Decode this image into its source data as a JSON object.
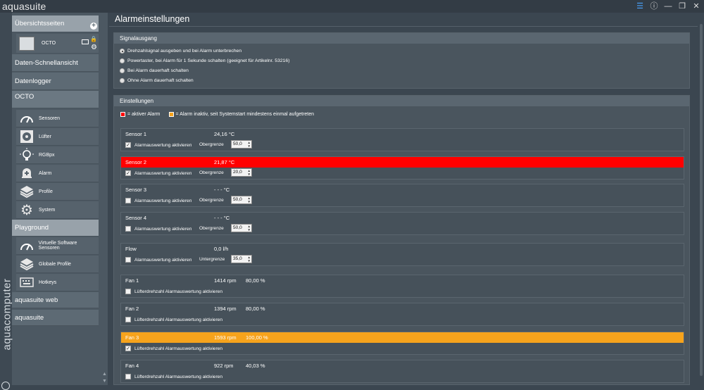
{
  "app": {
    "title": "aquasuite",
    "brand": "aquacomputer"
  },
  "colors": {
    "alarm_active": "#ff0000",
    "alarm_inactive": "#f6a31c",
    "accent": "#4aa3ff"
  },
  "sidebar": {
    "overview_label": "Übersichtsseiten",
    "device_label": "OCTO",
    "data_quick_label": "Daten-Schnellansicht",
    "datalogger_label": "Datenlogger",
    "octo_label": "OCTO",
    "octo_items": [
      {
        "label": "Sensoren",
        "icon": "gauge-icon"
      },
      {
        "label": "Lüfter",
        "icon": "fan-icon"
      },
      {
        "label": "RGBpx",
        "icon": "bulb-icon"
      },
      {
        "label": "Alarm",
        "icon": "alarm-icon"
      },
      {
        "label": "Profile",
        "icon": "layers-icon"
      },
      {
        "label": "System",
        "icon": "gear-icon"
      }
    ],
    "playground_label": "Playground",
    "playground_items": [
      {
        "label": "Virtuelle Software Sensoren",
        "icon": "gauge-icon"
      },
      {
        "label": "Globale Profile",
        "icon": "layers-icon"
      },
      {
        "label": "Hotkeys",
        "icon": "keyboard-icon"
      }
    ],
    "web_label": "aquasuite web",
    "suite_label": "aquasuite"
  },
  "main": {
    "title": "Alarmeinstellungen",
    "signal": {
      "header": "Signalausgang",
      "options": [
        "Drehzahlsignal ausgeben und bei Alarm unterbrechen",
        "Powertaster, bei Alarm für 1 Sekunde schalten (geeignet für Artikelnr. 53216)",
        "Bei Alarm dauerhaft schalten",
        "Ohne Alarm dauerhaft schalten"
      ],
      "selected": 0
    },
    "settings": {
      "header": "Einstellungen",
      "legend_active": "= aktiver Alarm",
      "legend_inactive": "= Alarm inaktiv, seit Systemstart mindestens einmal aufgetreten",
      "cards": [
        {
          "name": "Sensor 1",
          "value": "24,16 °C",
          "value2": "",
          "check": "Alarmauswertung aktivieren",
          "checked": true,
          "limit_label": "Obergrenze",
          "limit": "50,0",
          "state": "normal"
        },
        {
          "name": "Sensor 2",
          "value": "21,87 °C",
          "value2": "",
          "check": "Alarmauswertung aktivieren",
          "checked": true,
          "limit_label": "Obergrenze",
          "limit": "20,0",
          "state": "red"
        },
        {
          "name": "Sensor 3",
          "value": "- - - °C",
          "value2": "",
          "check": "Alarmauswertung aktivieren",
          "checked": false,
          "limit_label": "Obergrenze",
          "limit": "50,0",
          "state": "normal"
        },
        {
          "name": "Sensor 4",
          "value": "- - - °C",
          "value2": "",
          "check": "Alarmauswertung aktivieren",
          "checked": false,
          "limit_label": "Obergrenze",
          "limit": "50,0",
          "state": "normal"
        },
        {
          "name": "Flow",
          "value": "0,0 l/h",
          "value2": "",
          "check": "Alarmauswertung aktivieren",
          "checked": false,
          "limit_label": "Untergrenze",
          "limit": "35,0",
          "state": "normal"
        },
        {
          "name": "Fan 1",
          "value": "1414 rpm",
          "value2": "80,00 %",
          "check": "Lüfterdrehzahl Alarmauswertung aktivieren",
          "checked": false,
          "limit_label": "",
          "limit": "",
          "state": "normal"
        },
        {
          "name": "Fan 2",
          "value": "1394 rpm",
          "value2": "80,00 %",
          "check": "Lüfterdrehzahl Alarmauswertung aktivieren",
          "checked": false,
          "limit_label": "",
          "limit": "",
          "state": "normal"
        },
        {
          "name": "Fan 3",
          "value": "1593 rpm",
          "value2": "100,00 %",
          "check": "Lüfterdrehzahl Alarmauswertung aktivieren",
          "checked": true,
          "limit_label": "",
          "limit": "",
          "state": "orange"
        },
        {
          "name": "Fan 4",
          "value": "922 rpm",
          "value2": "40,03 %",
          "check": "Lüfterdrehzahl Alarmauswertung aktivieren",
          "checked": false,
          "limit_label": "",
          "limit": "",
          "state": "normal"
        }
      ]
    }
  }
}
